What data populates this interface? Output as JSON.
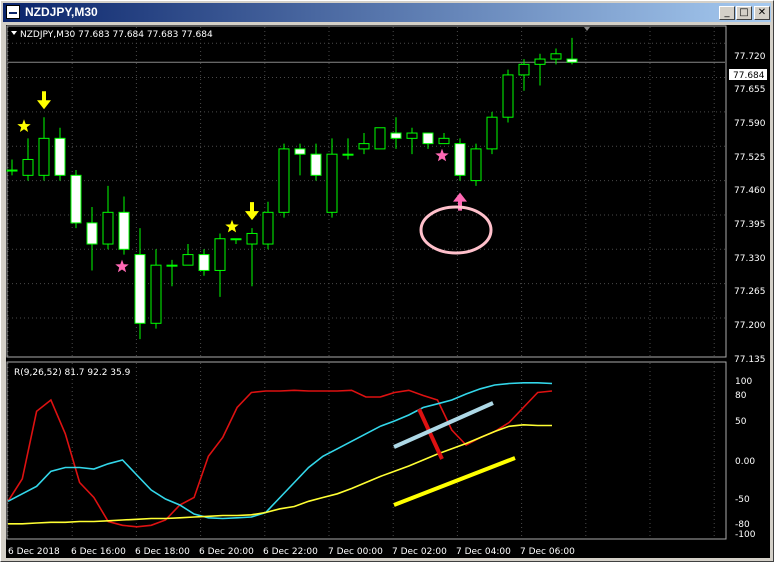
{
  "window": {
    "title": "NZDJPY,M30",
    "buttons": {
      "minimize": "_",
      "maximize": "□",
      "close": "✕"
    }
  },
  "main_panel": {
    "header": "NZDJPY,M30  77.683 77.684 77.683 77.684",
    "price_tag": "77.684",
    "y_ticks": [
      "77.720",
      "77.655",
      "77.590",
      "77.525",
      "77.460",
      "77.395",
      "77.330",
      "77.265",
      "77.200",
      "77.135"
    ]
  },
  "indicator_panel": {
    "header": "R(9,26,52) 81.7 92.2 35.9",
    "y_ticks": [
      "100",
      "80",
      "50",
      "0.00",
      "-50",
      "-80",
      "-100"
    ]
  },
  "x_ticks": [
    "6 Dec 2018",
    "6 Dec 16:00",
    "6 Dec 18:00",
    "6 Dec 20:00",
    "6 Dec 22:00",
    "7 Dec 00:00",
    "7 Dec 02:00",
    "7 Dec 04:00",
    "7 Dec 06:00"
  ],
  "colors": {
    "background": "#000000",
    "grid": "#4a4a4a",
    "bull": "#00ff00",
    "bullbody": "#000000",
    "bear": "#00ff00",
    "bearbody": "#ffffff",
    "sell_arrow": "#ffff00",
    "buy_arrow": "#ff69b4",
    "r_fast": "#dd1111",
    "r_mid": "#33d7ea",
    "r_slow": "#ffff33"
  },
  "chart_data": {
    "type": "candlestick",
    "symbol": "NZDJPY",
    "timeframe": "M30",
    "ylim": [
      77.13,
      77.745
    ],
    "candles": [
      {
        "o": 77.48,
        "h": 77.5,
        "l": 77.47,
        "c": 77.48
      },
      {
        "o": 77.47,
        "h": 77.54,
        "l": 77.46,
        "c": 77.5
      },
      {
        "o": 77.47,
        "h": 77.58,
        "l": 77.46,
        "c": 77.54
      },
      {
        "o": 77.54,
        "h": 77.56,
        "l": 77.46,
        "c": 77.47
      },
      {
        "o": 77.47,
        "h": 77.48,
        "l": 77.37,
        "c": 77.38
      },
      {
        "o": 77.38,
        "h": 77.41,
        "l": 77.29,
        "c": 77.34
      },
      {
        "o": 77.34,
        "h": 77.45,
        "l": 77.33,
        "c": 77.4
      },
      {
        "o": 77.4,
        "h": 77.43,
        "l": 77.32,
        "c": 77.33
      },
      {
        "o": 77.32,
        "h": 77.37,
        "l": 77.16,
        "c": 77.19
      },
      {
        "o": 77.19,
        "h": 77.33,
        "l": 77.18,
        "c": 77.3
      },
      {
        "o": 77.3,
        "h": 77.31,
        "l": 77.26,
        "c": 77.3
      },
      {
        "o": 77.3,
        "h": 77.34,
        "l": 77.3,
        "c": 77.32
      },
      {
        "o": 77.32,
        "h": 77.33,
        "l": 77.28,
        "c": 77.29
      },
      {
        "o": 77.29,
        "h": 77.36,
        "l": 77.24,
        "c": 77.35
      },
      {
        "o": 77.35,
        "h": 77.35,
        "l": 77.34,
        "c": 77.35
      },
      {
        "o": 77.34,
        "h": 77.37,
        "l": 77.26,
        "c": 77.36
      },
      {
        "o": 77.34,
        "h": 77.42,
        "l": 77.33,
        "c": 77.4
      },
      {
        "o": 77.4,
        "h": 77.53,
        "l": 77.39,
        "c": 77.52
      },
      {
        "o": 77.52,
        "h": 77.53,
        "l": 77.47,
        "c": 77.51
      },
      {
        "o": 77.51,
        "h": 77.53,
        "l": 77.46,
        "c": 77.47
      },
      {
        "o": 77.4,
        "h": 77.54,
        "l": 77.39,
        "c": 77.51
      },
      {
        "o": 77.51,
        "h": 77.54,
        "l": 77.5,
        "c": 77.51
      },
      {
        "o": 77.52,
        "h": 77.55,
        "l": 77.51,
        "c": 77.53
      },
      {
        "o": 77.52,
        "h": 77.56,
        "l": 77.52,
        "c": 77.56
      },
      {
        "o": 77.55,
        "h": 77.58,
        "l": 77.52,
        "c": 77.54
      },
      {
        "o": 77.54,
        "h": 77.56,
        "l": 77.51,
        "c": 77.55
      },
      {
        "o": 77.55,
        "h": 77.55,
        "l": 77.52,
        "c": 77.53
      },
      {
        "o": 77.53,
        "h": 77.55,
        "l": 77.53,
        "c": 77.54
      },
      {
        "o": 77.53,
        "h": 77.54,
        "l": 77.46,
        "c": 77.47
      },
      {
        "o": 77.46,
        "h": 77.53,
        "l": 77.45,
        "c": 77.52
      },
      {
        "o": 77.52,
        "h": 77.59,
        "l": 77.51,
        "c": 77.58
      },
      {
        "o": 77.58,
        "h": 77.67,
        "l": 77.57,
        "c": 77.66
      },
      {
        "o": 77.66,
        "h": 77.69,
        "l": 77.63,
        "c": 77.68
      },
      {
        "o": 77.68,
        "h": 77.7,
        "l": 77.64,
        "c": 77.69
      },
      {
        "o": 77.69,
        "h": 77.71,
        "l": 77.68,
        "c": 77.7
      },
      {
        "o": 77.69,
        "h": 77.73,
        "l": 77.68,
        "c": 77.684
      }
    ],
    "signals": [
      {
        "type": "sell",
        "index": 2
      },
      {
        "type": "sell",
        "index": 15
      },
      {
        "type": "buy",
        "index": 28
      },
      {
        "type": "star-sell",
        "index": 1
      },
      {
        "type": "star-sell",
        "index": 14
      },
      {
        "type": "star-buy",
        "index": 7
      },
      {
        "type": "star-buy",
        "index": 27
      }
    ],
    "indicator": {
      "name": "R(9,26,52)",
      "ylim": [
        -110,
        110
      ],
      "series": [
        {
          "color": "#dd1111",
          "values": [
            -65,
            -35,
            55,
            70,
            25,
            -40,
            -60,
            -92,
            -97,
            -99,
            -97,
            -90,
            -70,
            -60,
            -5,
            20,
            60,
            80,
            82,
            82,
            83,
            82,
            82,
            82,
            83,
            74,
            74,
            80,
            83,
            76,
            70,
            30,
            10,
            20,
            28,
            40,
            60,
            80,
            82
          ]
        },
        {
          "color": "#33d7ea",
          "values": [
            -65,
            -55,
            -45,
            -25,
            -20,
            -20,
            -22,
            -15,
            -10,
            -30,
            -50,
            -62,
            -70,
            -82,
            -87,
            -88,
            -87,
            -86,
            -80,
            -60,
            -40,
            -20,
            -5,
            5,
            15,
            25,
            35,
            42,
            50,
            60,
            65,
            70,
            78,
            85,
            90,
            92,
            93,
            93,
            92
          ]
        },
        {
          "color": "#ffff33",
          "values": [
            -95,
            -95,
            -94,
            -93,
            -93,
            -92,
            -92,
            -91,
            -90,
            -89,
            -88,
            -88,
            -87,
            -86,
            -85,
            -84,
            -84,
            -83,
            -80,
            -75,
            -72,
            -65,
            -60,
            -55,
            -48,
            -40,
            -32,
            -25,
            -18,
            -10,
            -2,
            5,
            12,
            20,
            28,
            35,
            37,
            36,
            36
          ]
        }
      ]
    }
  }
}
